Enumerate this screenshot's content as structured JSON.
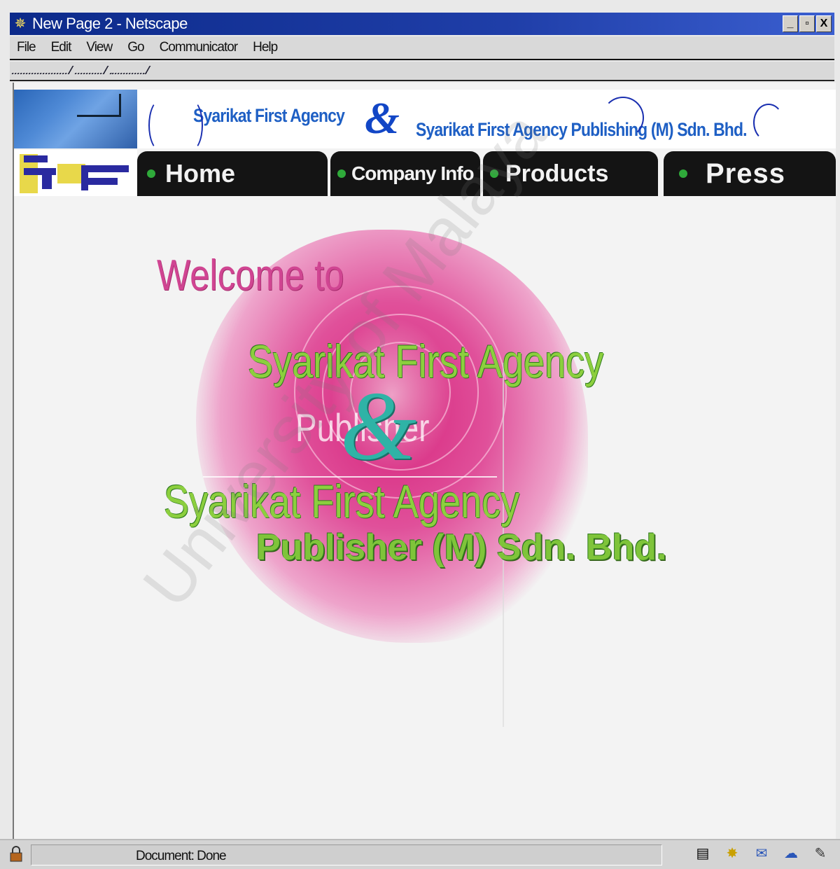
{
  "window": {
    "title": "New Page 2 - Netscape",
    "controls": [
      "_",
      "▫",
      "X"
    ]
  },
  "menu": {
    "items": [
      {
        "label": "File"
      },
      {
        "label": "Edit"
      },
      {
        "label": "View"
      },
      {
        "label": "Go"
      },
      {
        "label": "Communicator"
      },
      {
        "label": "Help"
      }
    ]
  },
  "header": {
    "brand_left": "Syarikat First Agency",
    "ampersand": "&",
    "brand_right": "Syarikat First Agency Publishing (M) Sdn. Bhd."
  },
  "nav": {
    "items": [
      {
        "label": "Home"
      },
      {
        "label": "Company Info"
      },
      {
        "label": "Products"
      },
      {
        "label": "Press"
      }
    ]
  },
  "splash": {
    "welcome": "Welcome to",
    "line1": "Syarikat First Agency",
    "ghost": "Publisher",
    "ampersand": "&",
    "line2": "Syarikat First Agency",
    "line3": "Publisher (M) Sdn. Bhd."
  },
  "watermark": "University of Malaya",
  "status": {
    "text": "Document: Done"
  },
  "colors": {
    "titlebar": "#0c2a8a",
    "nav_bg": "#141414",
    "nav_dot": "#2faa3a",
    "header_text": "#1e5fc4",
    "welcome_pink": "#d04592",
    "agency_green": "#8ccf3e",
    "ampersand_teal": "#2fb3a6"
  }
}
